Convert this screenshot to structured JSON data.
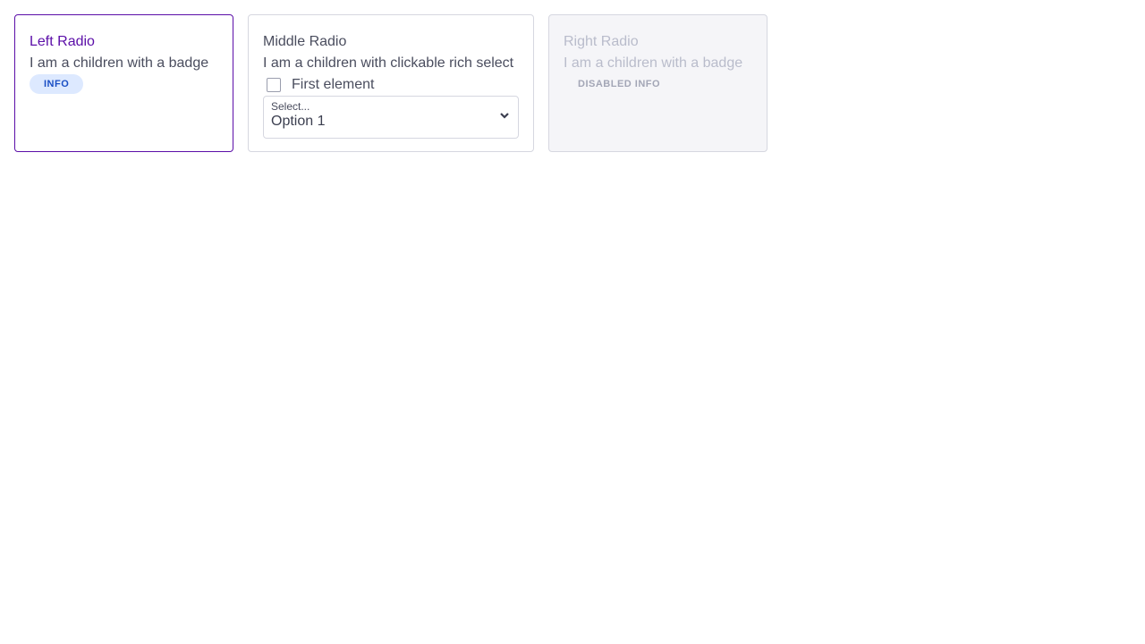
{
  "cards": [
    {
      "title": "Left Radio",
      "description": "I am a children with a badge",
      "badge": "INFO",
      "selected": true
    },
    {
      "title": "Middle Radio",
      "description": "I am a children with clickable rich select",
      "checkbox_label": "First element",
      "checked": false,
      "select": {
        "label": "Select...",
        "value": "Option 1"
      }
    },
    {
      "title": "Right Radio",
      "description": "I am a children with a badge",
      "badge": "DISABLED INFO",
      "disabled": true
    }
  ],
  "colors": {
    "accent": "#5b0ea8",
    "badge_bg": "#dde9ff",
    "badge_text": "#1a4fc4"
  }
}
